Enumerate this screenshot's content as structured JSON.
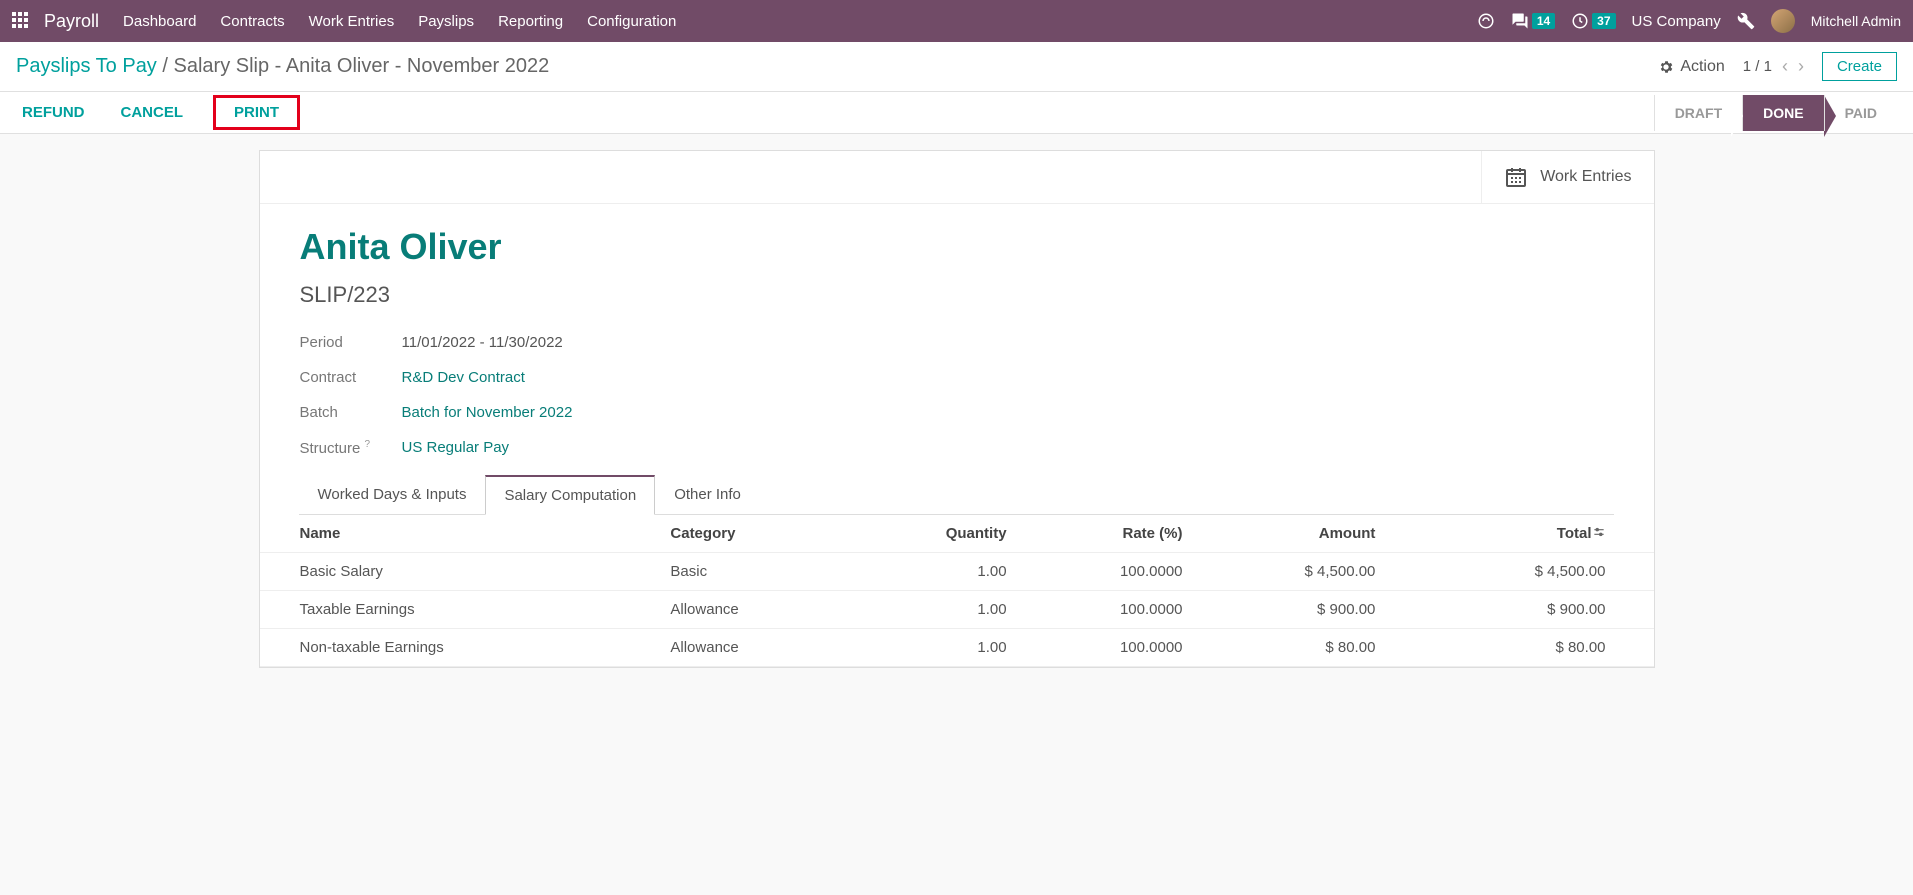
{
  "topnav": {
    "brand": "Payroll",
    "menu": [
      "Dashboard",
      "Contracts",
      "Work Entries",
      "Payslips",
      "Reporting",
      "Configuration"
    ],
    "msg_count": "14",
    "activity_count": "37",
    "company": "US Company",
    "user": "Mitchell Admin"
  },
  "breadcrumb": {
    "parent": "Payslips To Pay",
    "current": "Salary Slip - Anita Oliver - November 2022",
    "action_label": "Action",
    "pager": "1 / 1",
    "create": "Create"
  },
  "buttons": {
    "refund": "REFUND",
    "cancel": "CANCEL",
    "print": "PRINT"
  },
  "statuses": {
    "draft": "DRAFT",
    "done": "DONE",
    "paid": "PAID"
  },
  "sheet": {
    "work_entries": "Work Entries",
    "employee": "Anita Oliver",
    "slip": "SLIP/223",
    "fields": {
      "period_label": "Period",
      "period_value": "11/01/2022 - 11/30/2022",
      "contract_label": "Contract",
      "contract_value": "R&D Dev Contract",
      "batch_label": "Batch",
      "batch_value": "Batch for November 2022",
      "structure_label": "Structure",
      "structure_value": "US Regular Pay"
    },
    "tabs": {
      "t1": "Worked Days & Inputs",
      "t2": "Salary Computation",
      "t3": "Other Info"
    },
    "table": {
      "headers": {
        "name": "Name",
        "category": "Category",
        "quantity": "Quantity",
        "rate": "Rate (%)",
        "amount": "Amount",
        "total": "Total"
      },
      "rows": [
        {
          "name": "Basic Salary",
          "category": "Basic",
          "quantity": "1.00",
          "rate": "100.0000",
          "amount": "$ 4,500.00",
          "total": "$ 4,500.00"
        },
        {
          "name": "Taxable Earnings",
          "category": "Allowance",
          "quantity": "1.00",
          "rate": "100.0000",
          "amount": "$ 900.00",
          "total": "$ 900.00"
        },
        {
          "name": "Non-taxable Earnings",
          "category": "Allowance",
          "quantity": "1.00",
          "rate": "100.0000",
          "amount": "$ 80.00",
          "total": "$ 80.00"
        }
      ]
    }
  }
}
